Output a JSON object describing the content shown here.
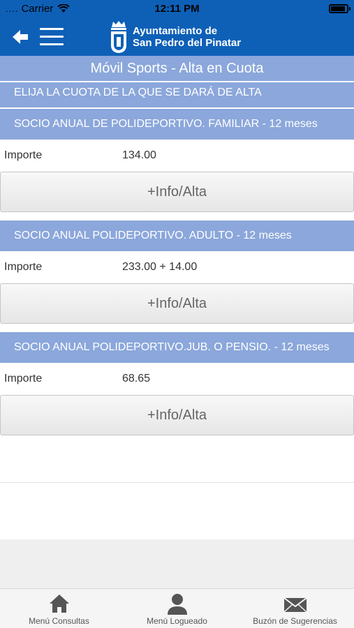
{
  "status_bar": {
    "carrier": "Carrier",
    "time": "12:11 PM",
    "signal": "....",
    "wifi_icon": "wifi-icon",
    "battery_icon": "battery-icon"
  },
  "header": {
    "logo_line1": "Ayuntamiento de",
    "logo_line2": "San Pedro del Pinatar",
    "colors": {
      "primary": "#0e60b7",
      "section": "#8ba7db"
    }
  },
  "page_title": "Móvil Sports - Alta en Cuota",
  "instruction": "ELIJA LA CUOTA DE LA QUE SE DARÁ DE ALTA",
  "quotas": [
    {
      "title": "SOCIO ANUAL DE POLIDEPORTIVO. FAMILIAR - 12 meses",
      "label": "Importe",
      "amount": "134.00",
      "button": "+Info/Alta"
    },
    {
      "title": "SOCIO ANUAL POLIDEPORTIVO. ADULTO - 12 meses",
      "label": "Importe",
      "amount": "233.00 + 14.00",
      "button": "+Info/Alta"
    },
    {
      "title": "SOCIO ANUAL POLIDEPORTIVO.JUB. O PENSIO. - 12 meses",
      "label": "Importe",
      "amount": "68.65",
      "button": "+Info/Alta"
    }
  ],
  "tabs": [
    {
      "label": "Menú Consultas",
      "icon": "home-icon"
    },
    {
      "label": "Menú Logueado",
      "icon": "user-icon"
    },
    {
      "label": "Buzón de Sugerencias",
      "icon": "envelope-icon"
    }
  ]
}
